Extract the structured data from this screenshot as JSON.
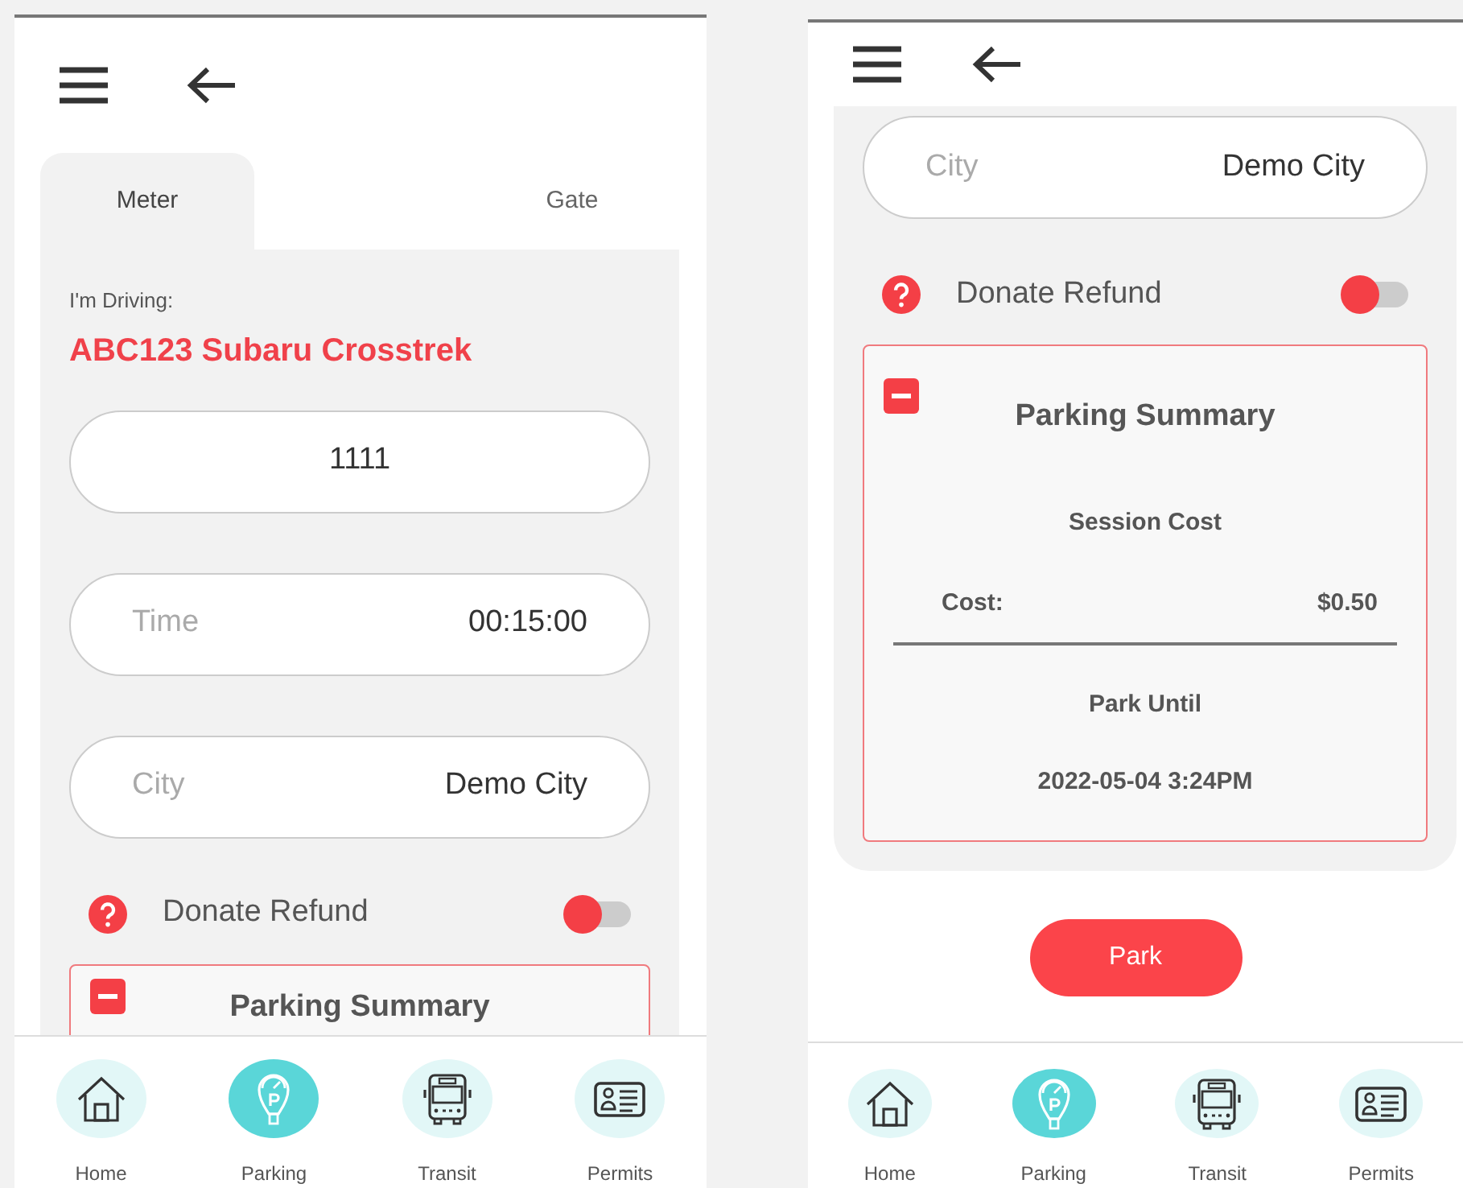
{
  "screens": [
    {
      "tabs": [
        {
          "label": "Meter",
          "selected": true
        },
        {
          "label": "Gate",
          "selected": false
        }
      ],
      "sections": [
        {
          "kind": "driving",
          "label": "I'm Driving:",
          "vehicle": "ABC123 Subaru Crosstrek"
        },
        {
          "kind": "field",
          "value": "1111"
        },
        {
          "kind": "field",
          "label": "Time",
          "value": "00:15:00"
        },
        {
          "kind": "field",
          "label": "City",
          "value": "Demo City"
        },
        {
          "kind": "toggle",
          "label": "Donate Refund",
          "on": false
        },
        {
          "kind": "summary",
          "title": "Parking Summary",
          "expanded": true
        }
      ],
      "nav": [
        {
          "label": "Home",
          "selected": false
        },
        {
          "label": "Parking",
          "selected": true
        },
        {
          "label": "Transit",
          "selected": false
        },
        {
          "label": "Permits",
          "selected": false
        }
      ]
    },
    {
      "sections": [
        {
          "kind": "field",
          "label": "City",
          "value": "Demo City"
        },
        {
          "kind": "toggle",
          "label": "Donate Refund",
          "on": false
        },
        {
          "kind": "summary",
          "title": "Parking Summary",
          "expanded": true,
          "session_cost_title": "Session Cost",
          "cost_label": "Cost:",
          "cost_value": "$0.50",
          "park_until_title": "Park Until",
          "park_until_value": "2022-05-04 3:24PM"
        }
      ],
      "park_button": "Park",
      "nav": [
        {
          "label": "Home",
          "selected": false
        },
        {
          "label": "Parking",
          "selected": true
        },
        {
          "label": "Transit",
          "selected": false
        },
        {
          "label": "Permits",
          "selected": false
        }
      ]
    }
  ]
}
